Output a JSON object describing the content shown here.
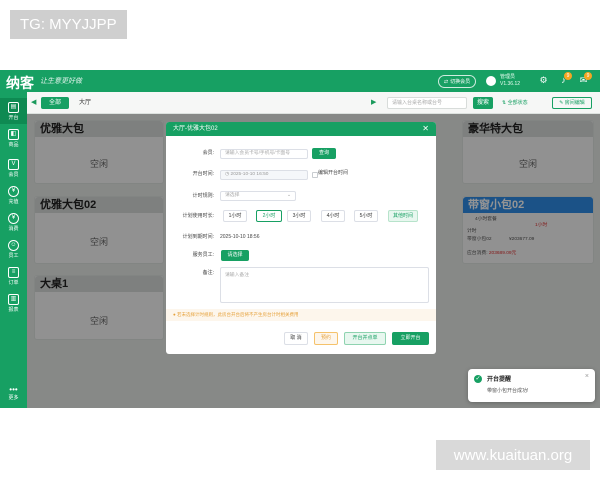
{
  "tg_label": "TG: MYYJJPP",
  "watermark": "www.kuaituan.org",
  "topbar": {
    "brand": "纳客",
    "slogan": "让生意更好做",
    "switch_button": "切换会员",
    "user_name": "管理员",
    "user_version": "V1.36.12",
    "notify_count": "9",
    "message_count": "9"
  },
  "sidebar": {
    "items": [
      {
        "label": "开台",
        "icon": "table-icon"
      },
      {
        "label": "商品",
        "icon": "goods-icon"
      },
      {
        "label": "会员",
        "icon": "vip-icon"
      },
      {
        "label": "充值",
        "icon": "recharge-icon"
      },
      {
        "label": "消费",
        "icon": "consume-icon"
      },
      {
        "label": "员工",
        "icon": "staff-icon"
      },
      {
        "label": "订单",
        "icon": "order-icon"
      },
      {
        "label": "报表",
        "icon": "report-icon"
      },
      {
        "label": "更多",
        "icon": "more-icon"
      }
    ]
  },
  "subbar": {
    "tab_all": "全部",
    "tab_hall": "大厅",
    "search_placeholder": "请输入台桌名称或台号",
    "search_button": "搜索",
    "status_link": "全部状态",
    "edit_button": "房间编辑"
  },
  "cards": {
    "c1_title": "优雅大包",
    "c1_status": "空闲",
    "c2_title": "优雅大包02",
    "c2_status": "空闲",
    "c3_title": "大桌1",
    "c3_status": "空闲",
    "c4_title": "豪华特大包",
    "c4_status": "空闲",
    "c5_title": "带窗小包02",
    "c5_line1": "4小时套餐",
    "c5_line2": "计时",
    "c5_amount1": "¥203677.09",
    "c5_line3": "带窗小包02",
    "c5_line4": "¥203677.09",
    "c5_due_label": "应台消费:",
    "c5_due_value": "203689.09元",
    "c5_hours": "1小时"
  },
  "modal": {
    "title": "大厅-优雅大包02",
    "member_label": "会员:",
    "member_placeholder": "请输入会员卡号/手机号/卡面号",
    "query_button": "查询",
    "start_label": "开台时间:",
    "start_value": "2025-10-10 16:50",
    "edit_start_label": "编辑开台时间",
    "rule_label": "计时规则:",
    "rule_placeholder": "请选择",
    "duration_label": "计划使用时长:",
    "durations": [
      "1小时",
      "2小时",
      "3小时",
      "4小时",
      "5小时"
    ],
    "duration_other": "其他时间",
    "end_label": "计划到期时间:",
    "end_value": "2025-10-10 18:56",
    "staff_label": "服务员工:",
    "staff_button": "请选择",
    "remark_label": "备注:",
    "remark_placeholder": "请输入备注",
    "warning": "若未选择计时规则，此房台开台后将不产生房台计时相关费用",
    "btn_cancel": "取 消",
    "btn_reserve": "预约",
    "btn_order": "开台并点单",
    "btn_open": "立即开台"
  },
  "toast": {
    "title": "开台提醒",
    "message": "带窗小包开台成功!"
  },
  "colors": {
    "brand_green": "#17a063",
    "card_blue": "#2f8ee9",
    "warn_orange": "#e6a23c",
    "alert_red": "#e03131"
  }
}
